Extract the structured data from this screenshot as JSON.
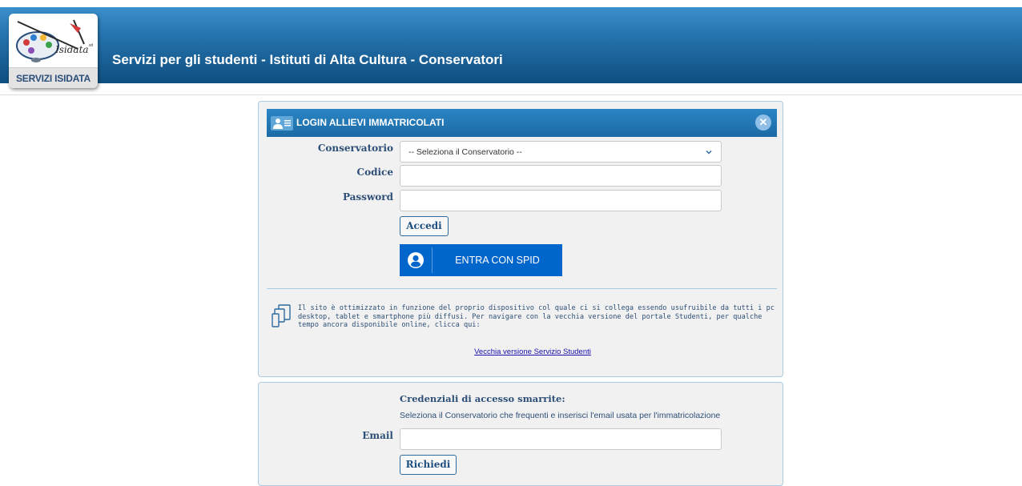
{
  "header": {
    "title": "Servizi per gli studenti - Istituti di Alta Cultura - Conservatori",
    "logo_label": "SERVIZI ISIDATA",
    "logo_wordmark": "Isidata",
    "logo_superscript": "srl"
  },
  "login": {
    "title": "LOGIN ALLIEVI IMMATRICOLATI",
    "close_glyph": "✕",
    "conservatorio_label": "Conservatorio",
    "conservatorio_selected": "-- Seleziona il Conservatorio --",
    "codice_label": "Codice",
    "codice_value": "",
    "password_label": "Password",
    "password_value": "",
    "accedi_label": "Accedi",
    "spid_label": "ENTRA CON SPID",
    "info_text": "Il sito è ottimizzato in funzione del proprio dispositivo col quale ci si collega essendo usufruibile da tutti i pc desktop, tablet e smartphone più diffusi. Per navigare con la vecchia versione del portale Studenti, per qualche tempo ancora disponibile online, clicca qui:",
    "old_version_link": "Vecchia versione Servizio Studenti"
  },
  "recover": {
    "title": "Credenziali di accesso smarrite:",
    "subtitle": "Seleziona il Conservatorio che frequenti e inserisci l'email usata per l'immatricolazione",
    "email_label": "Email",
    "email_value": "",
    "request_label": "Richiedi"
  },
  "colors": {
    "header_top": "#3a8fcb",
    "header_bottom": "#0f4f80",
    "panel_head": "#1c6aa5",
    "spid_blue": "#0066cc",
    "label_text": "#2d4f77"
  }
}
